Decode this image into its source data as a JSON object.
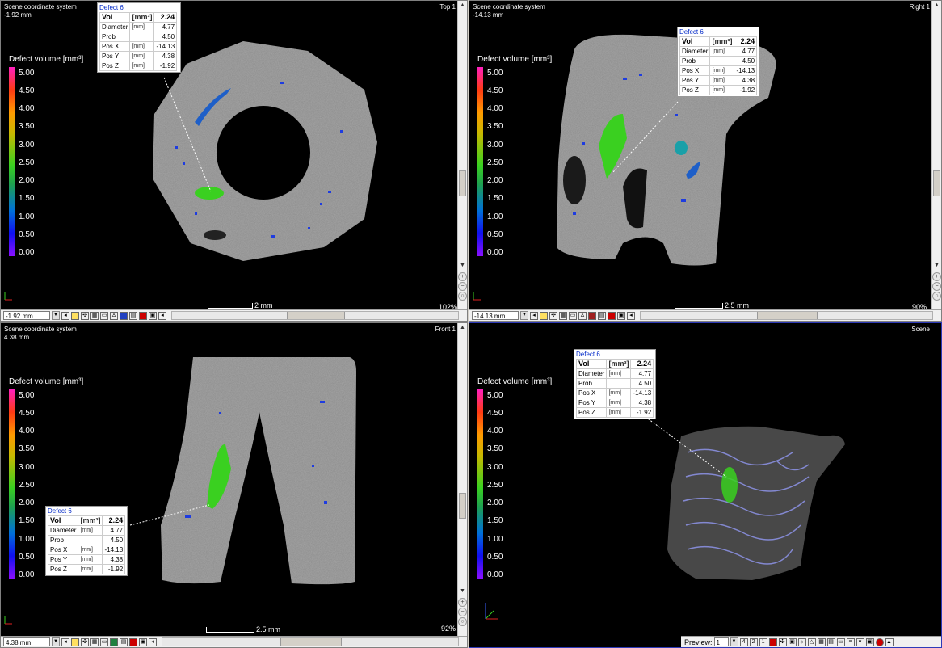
{
  "colorbar": {
    "label": "Defect volume [mm³]",
    "ticks": [
      "5.00",
      "4.50",
      "4.00",
      "3.50",
      "3.00",
      "2.50",
      "2.00",
      "1.50",
      "1.00",
      "0.50",
      "0.00"
    ]
  },
  "defect": {
    "title": "Defect 6",
    "rows": [
      {
        "name": "Vol",
        "unit": "[mm³]",
        "value": "2.24"
      },
      {
        "name": "Diameter",
        "unit": "[mm]",
        "value": "4.77"
      },
      {
        "name": "Prob",
        "unit": "",
        "value": "4.50"
      },
      {
        "name": "Pos X",
        "unit": "[mm]",
        "value": "-14.13"
      },
      {
        "name": "Pos Y",
        "unit": "[mm]",
        "value": "4.38"
      },
      {
        "name": "Pos Z",
        "unit": "[mm]",
        "value": "-1.92"
      }
    ]
  },
  "views": {
    "top": {
      "coord": "Scene coordinate system",
      "offset": "-1.92 mm",
      "name": "Top 1",
      "scale": "2 mm",
      "zoom": "102%",
      "slice": "-1.92 mm"
    },
    "right": {
      "coord": "Scene coordinate system",
      "offset": "-14.13 mm",
      "name": "Right 1",
      "scale": "2.5 mm",
      "zoom": "90%",
      "slice": "-14.13 mm"
    },
    "front": {
      "coord": "Scene coordinate system",
      "offset": "4.38 mm",
      "name": "Front 1",
      "scale": "2.5 mm",
      "zoom": "92%",
      "slice": "4.38 mm"
    },
    "scene": {
      "name": "Scene",
      "preview_label": "Preview:",
      "preview_value": "1"
    }
  },
  "colors": {
    "accent": "#2d3ab8",
    "defect_green": "#3ad020",
    "defect_blue": "#1e5fc8"
  }
}
